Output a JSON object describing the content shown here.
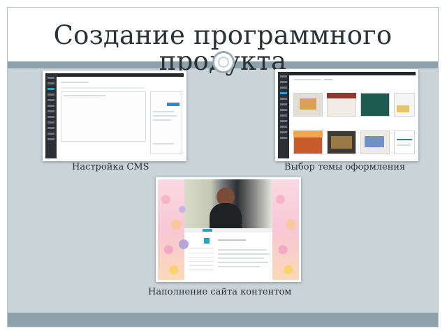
{
  "slide": {
    "title": "Создание программного продукта"
  },
  "items": [
    {
      "caption": "Настройка CMS"
    },
    {
      "caption": "Выбор темы оформления"
    },
    {
      "caption": "Наполнение сайта контентом"
    }
  ],
  "colors": {
    "background": "#c9d4d9",
    "band": "#8ea2ab",
    "title_text": "#2c3135"
  }
}
